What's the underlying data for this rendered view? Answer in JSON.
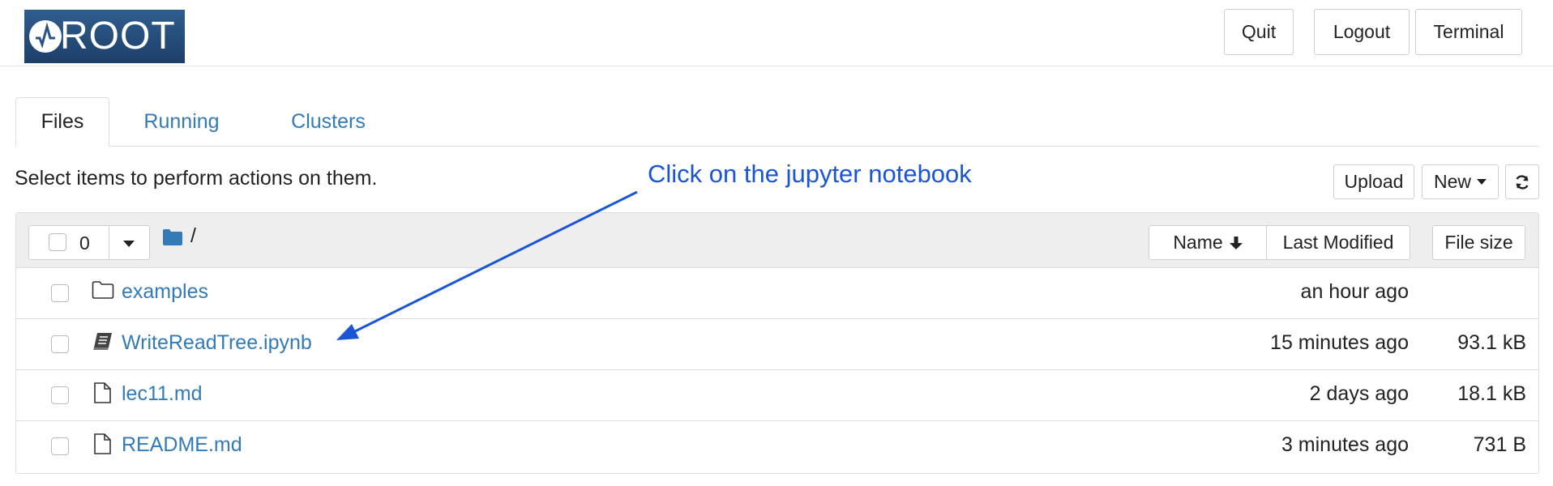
{
  "header": {
    "logo_text": "ROOT",
    "buttons": {
      "quit": "Quit",
      "logout": "Logout",
      "terminal": "Terminal"
    }
  },
  "tabs": [
    {
      "label": "Files",
      "active": true
    },
    {
      "label": "Running",
      "active": false
    },
    {
      "label": "Clusters",
      "active": false
    }
  ],
  "toolbar": {
    "instruction": "Select items to perform actions on them.",
    "upload": "Upload",
    "new": "New"
  },
  "annotation": "Click on the jupyter notebook",
  "list_header": {
    "selected_count": "0",
    "path": "/",
    "sort_name": "Name",
    "sort_modified": "Last Modified",
    "sort_size": "File size"
  },
  "files": [
    {
      "name": "examples",
      "type": "folder",
      "modified": "an hour ago",
      "size": ""
    },
    {
      "name": "WriteReadTree.ipynb",
      "type": "notebook",
      "modified": "15 minutes ago",
      "size": "93.1 kB"
    },
    {
      "name": "lec11.md",
      "type": "file",
      "modified": "2 days ago",
      "size": "18.1 kB"
    },
    {
      "name": "README.md",
      "type": "file",
      "modified": "3 minutes ago",
      "size": "731 B"
    }
  ],
  "colors": {
    "link": "#337ab7",
    "annotation": "#1a55d6",
    "logo_bg": "#2a5283"
  }
}
